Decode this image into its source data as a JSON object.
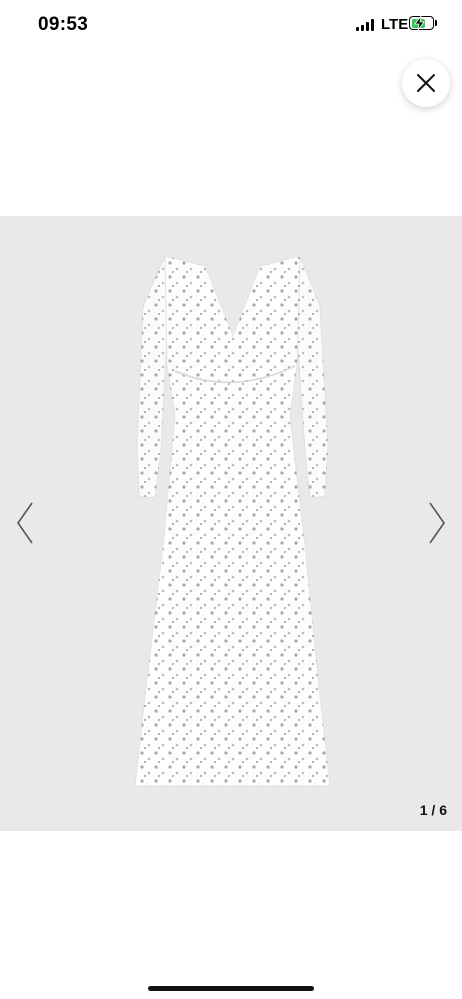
{
  "status_bar": {
    "time": "09:53",
    "network": "LTE",
    "signal_icon": "cellular-signal-icon",
    "battery_icon": "battery-charging-icon",
    "battery_color": "#34c759"
  },
  "close_button": {
    "icon": "close-icon"
  },
  "gallery": {
    "counter": "1 / 6",
    "prev_icon": "chevron-left-icon",
    "next_icon": "chevron-right-icon",
    "image_description_icon": "product-image",
    "background_color": "#e9e9e9"
  }
}
